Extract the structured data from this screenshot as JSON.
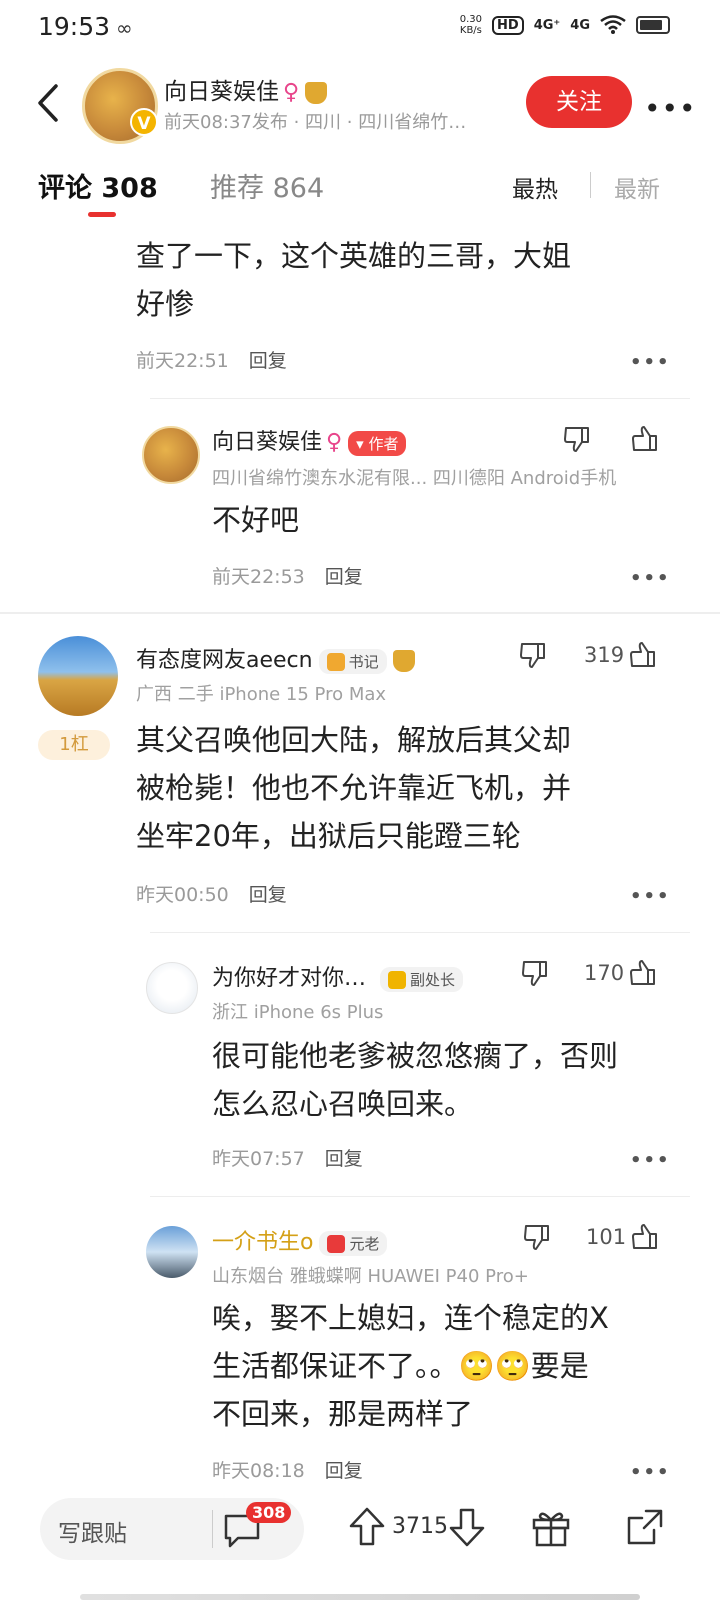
{
  "status_bar": {
    "time": "19:53",
    "net_speed_value": "0.30",
    "net_speed_unit": "KB/s",
    "hd_label": "HD",
    "signal1": "4G⁺",
    "signal2": "4G"
  },
  "header": {
    "author_name": "向日葵娱佳",
    "publish_meta": "前天08:37发布 · 四川 · 四川省绵竹…",
    "follow_label": "关注",
    "more_label": "•••",
    "verified_mark": "V"
  },
  "tabs": {
    "comments_label": "评论 308",
    "recommend_label": "推荐 864",
    "sort_hot": "最热",
    "sort_new": "最新"
  },
  "partial_comment": {
    "text_line1": "查了一下，这个英雄的三哥，大姐",
    "text_line2": "好惨",
    "time": "前天22:51",
    "reply": "回复"
  },
  "author_reply": {
    "name": "向日葵娱佳",
    "badge": "作者",
    "meta": "四川省绵竹澳东水泥有限... 四川德阳  Android手机",
    "text": "不好吧",
    "time": "前天22:53",
    "reply": "回复"
  },
  "main_comment": {
    "name": "有态度网友aeecn",
    "badge": "书记",
    "meta": "广西  二手  iPhone 15 Pro Max",
    "likes": "319",
    "floor": "1杠",
    "text_line1": "其父召唤他回大陆，解放后其父却",
    "text_line2": "被枪毙！他也不允许靠近飞机，并",
    "text_line3": "坐牢20年，出狱后只能蹬三轮",
    "time": "昨天00:50",
    "reply": "回复"
  },
  "replies": [
    {
      "name": "为你好才对你…",
      "badge": "副处长",
      "meta": "浙江  iPhone 6s Plus",
      "likes": "170",
      "text_line1": "很可能他老爹被忽悠瘸了，否则",
      "text_line2": "怎么忍心召唤回来。",
      "time": "昨天07:57",
      "reply": "回复"
    },
    {
      "name": "一介书生o",
      "badge": "元老",
      "meta": "山东烟台  雅蛾蝶啊  HUAWEI P40 Pro+",
      "likes": "101",
      "text_line1": "唉，娶不上媳妇，连个稳定的X",
      "text_line2a": "生活都保证不了。。",
      "text_line2b": "要是",
      "text_line3": "不回来，那是两样了",
      "time": "昨天08:18",
      "reply": "回复"
    }
  ],
  "bottom_bar": {
    "compose_placeholder": "写跟贴",
    "comment_count": "308",
    "vote_count": "3715"
  },
  "colors": {
    "accent_red": "#e8312f",
    "gold": "#d4a017",
    "meta_gray": "#9a9a9a"
  }
}
